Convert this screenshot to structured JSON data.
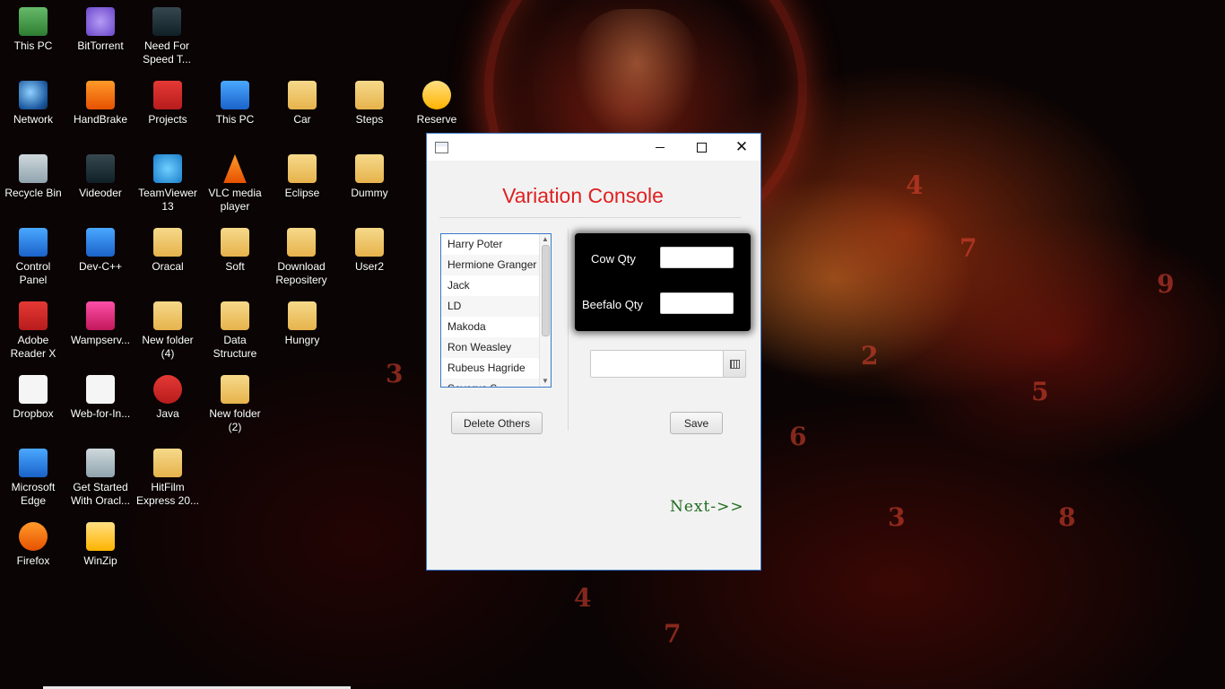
{
  "desktop": {
    "icons": [
      {
        "label": "This PC",
        "icon": "monitor-icon"
      },
      {
        "label": "BitTorrent",
        "icon": "bittorrent-icon"
      },
      {
        "label": "Need For Speed T...",
        "icon": "nfs-icon"
      },
      {
        "label": "Network",
        "icon": "network-globe-icon"
      },
      {
        "label": "HandBrake",
        "icon": "handbrake-icon"
      },
      {
        "label": "Projects",
        "icon": "torii-icon"
      },
      {
        "label": "This PC",
        "icon": "monitor-icon"
      },
      {
        "label": "Car",
        "icon": "folder-icon"
      },
      {
        "label": "Steps",
        "icon": "folder-icon"
      },
      {
        "label": "Reserve",
        "icon": "chrome-icon"
      },
      {
        "label": "Recycle Bin",
        "icon": "recycle-bin-icon"
      },
      {
        "label": "Videoder",
        "icon": "videoder-icon"
      },
      {
        "label": "TeamViewer 13",
        "icon": "teamviewer-icon"
      },
      {
        "label": "VLC media player",
        "icon": "vlc-cone-icon"
      },
      {
        "label": "Eclipse",
        "icon": "folder-icon"
      },
      {
        "label": "Dummy",
        "icon": "folder-icon"
      },
      {
        "label": "Control Panel",
        "icon": "control-panel-icon"
      },
      {
        "label": "Dev-C++",
        "icon": "devcpp-icon"
      },
      {
        "label": "Oracal",
        "icon": "folder-icon"
      },
      {
        "label": "Soft",
        "icon": "folder-icon"
      },
      {
        "label": "Download Repositery",
        "icon": "folder-icon"
      },
      {
        "label": "User2",
        "icon": "folder-icon"
      },
      {
        "label": "Adobe Reader X",
        "icon": "adobe-reader-icon"
      },
      {
        "label": "Wampserv...",
        "icon": "wampserver-icon"
      },
      {
        "label": "New folder (4)",
        "icon": "folder-icon"
      },
      {
        "label": "Data Structure",
        "icon": "folder-icon"
      },
      {
        "label": "Hungry",
        "icon": "folder-icon"
      },
      {
        "label": "Dropbox",
        "icon": "dropbox-icon"
      },
      {
        "label": "Web-for-In...",
        "icon": "web-icon"
      },
      {
        "label": "Java",
        "icon": "java-icon"
      },
      {
        "label": "New folder (2)",
        "icon": "folder-icon"
      },
      {
        "label": "Microsoft Edge",
        "icon": "edge-icon"
      },
      {
        "label": "Get Started With Oracl...",
        "icon": "oracle-db-icon"
      },
      {
        "label": "HitFilm Express 20...",
        "icon": "folder-icon"
      },
      {
        "label": "Firefox",
        "icon": "firefox-icon"
      },
      {
        "label": "WinZip",
        "icon": "winzip-icon"
      }
    ]
  },
  "window": {
    "title": "",
    "controls": {
      "minimize": "minimize",
      "maximize": "maximize",
      "close": "close"
    },
    "heading": "Variation Console",
    "heading_color": "#e02020",
    "names_list": [
      "Harry Poter",
      "Hermione Granger",
      "Jack",
      "LD",
      "Makoda",
      "Ron Weasley",
      "Rubeus Hagride",
      "Severus S..."
    ],
    "qty_panel": {
      "cow_label": "Cow Qty",
      "cow_value": "",
      "beefalo_label": "Beefalo Qty",
      "beefalo_value": ""
    },
    "date_picker": {
      "value": "",
      "icon": "calendar-icon"
    },
    "delete_button": "Delete Others",
    "save_button": "Save",
    "next_link": "Next->>",
    "next_color": "#1d6b1d",
    "accent": "#3b79c9"
  }
}
